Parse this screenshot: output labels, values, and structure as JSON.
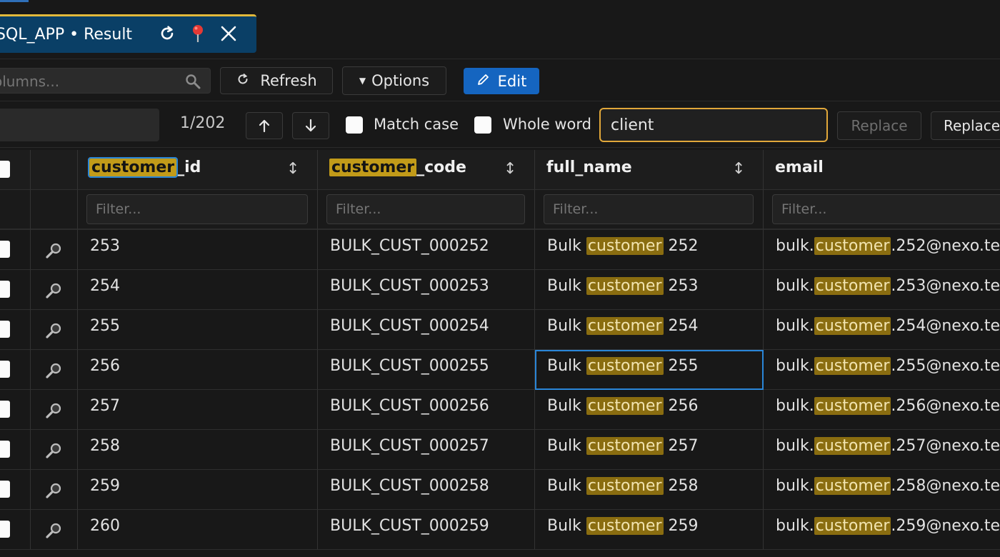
{
  "tab": {
    "title": "SQL_APP • Result",
    "icons": [
      "refresh-icon",
      "pin-icon",
      "close-icon"
    ]
  },
  "toolbar": {
    "column_search_placeholder": "olumns...",
    "refresh_label": "Refresh",
    "options_label": "Options",
    "edit_label": "Edit"
  },
  "find": {
    "counter": "1/202",
    "match_case_label": "Match case",
    "whole_word_label": "Whole word",
    "replace_value": "client",
    "replace_label": "Replace",
    "replace_all_label": "Replace"
  },
  "search_term": "customer",
  "columns": [
    {
      "prefix": "customer",
      "rest": "_id"
    },
    {
      "prefix": "customer",
      "rest": "_code"
    },
    {
      "prefix": "",
      "rest": "full_name"
    },
    {
      "prefix": "",
      "rest": "email"
    }
  ],
  "filter_placeholder": "Filter...",
  "rows": [
    {
      "id": "253",
      "code": "BULK_CUST_000252",
      "name_pre": "Bulk ",
      "name_hl": "customer",
      "name_post": " 252",
      "email_pre": "bulk.",
      "email_hl": "customer",
      "email_post": ".252@nexo.te"
    },
    {
      "id": "254",
      "code": "BULK_CUST_000253",
      "name_pre": "Bulk ",
      "name_hl": "customer",
      "name_post": " 253",
      "email_pre": "bulk.",
      "email_hl": "customer",
      "email_post": ".253@nexo.te"
    },
    {
      "id": "255",
      "code": "BULK_CUST_000254",
      "name_pre": "Bulk ",
      "name_hl": "customer",
      "name_post": " 254",
      "email_pre": "bulk.",
      "email_hl": "customer",
      "email_post": ".254@nexo.te"
    },
    {
      "id": "256",
      "code": "BULK_CUST_000255",
      "name_pre": "Bulk ",
      "name_hl": "customer",
      "name_post": " 255",
      "email_pre": "bulk.",
      "email_hl": "customer",
      "email_post": ".255@nexo.te"
    },
    {
      "id": "257",
      "code": "BULK_CUST_000256",
      "name_pre": "Bulk ",
      "name_hl": "customer",
      "name_post": " 256",
      "email_pre": "bulk.",
      "email_hl": "customer",
      "email_post": ".256@nexo.te"
    },
    {
      "id": "258",
      "code": "BULK_CUST_000257",
      "name_pre": "Bulk ",
      "name_hl": "customer",
      "name_post": " 257",
      "email_pre": "bulk.",
      "email_hl": "customer",
      "email_post": ".257@nexo.te"
    },
    {
      "id": "259",
      "code": "BULK_CUST_000258",
      "name_pre": "Bulk ",
      "name_hl": "customer",
      "name_post": " 258",
      "email_pre": "bulk.",
      "email_hl": "customer",
      "email_post": ".258@nexo.te"
    },
    {
      "id": "260",
      "code": "BULK_CUST_000259",
      "name_pre": "Bulk ",
      "name_hl": "customer",
      "name_post": " 259",
      "email_pre": "bulk.",
      "email_hl": "customer",
      "email_post": ".259@nexo.te"
    }
  ],
  "colors": {
    "highlight": "#8a6d10",
    "header_highlight": "#c29b19",
    "accent": "#1565c0",
    "focus": "#e2a83a",
    "tab_bg": "#0a3f66"
  }
}
